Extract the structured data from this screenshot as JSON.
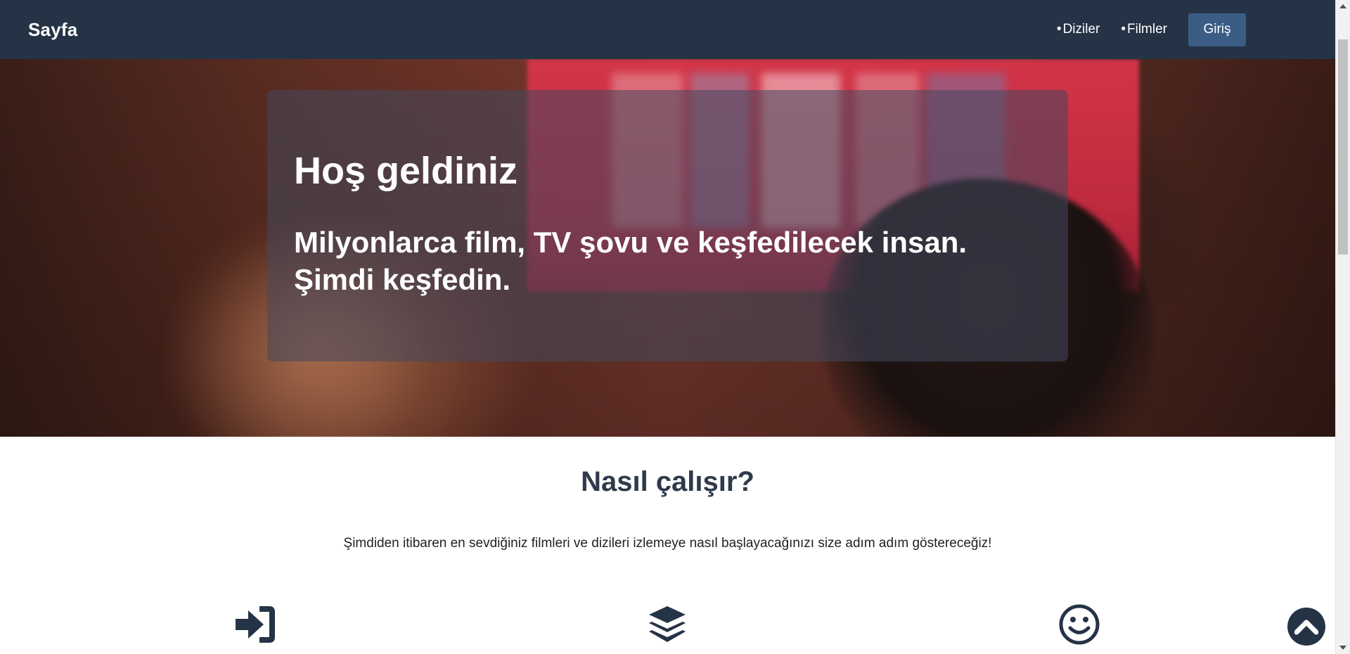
{
  "navbar": {
    "brand": "Sayfa",
    "links": [
      {
        "bullet": "•",
        "label": "Diziler"
      },
      {
        "bullet": "•",
        "label": "Filmler"
      }
    ],
    "login_label": "Giriş"
  },
  "hero": {
    "title": "Hoş geldiniz",
    "subtitle": "Milyonlarca film, TV şovu ve keşfedilecek insan. Şimdi keşfedin."
  },
  "how_it_works": {
    "title": "Nasıl çalışır?",
    "description": "Şimdiden itibaren en sevdiğiniz filmleri ve dizileri izlemeye nasıl başlayacağınızı size adım adım göstereceğiz!",
    "features": [
      {
        "icon": "sign-in-icon"
      },
      {
        "icon": "layers-icon"
      },
      {
        "icon": "smile-icon"
      }
    ]
  },
  "colors": {
    "navbar_bg": "#253346",
    "login_button_bg": "#3b5c85",
    "heading_text": "#2f3a4c",
    "icon_color": "#253346"
  },
  "back_to_top": {
    "icon": "chevron-up-icon"
  }
}
